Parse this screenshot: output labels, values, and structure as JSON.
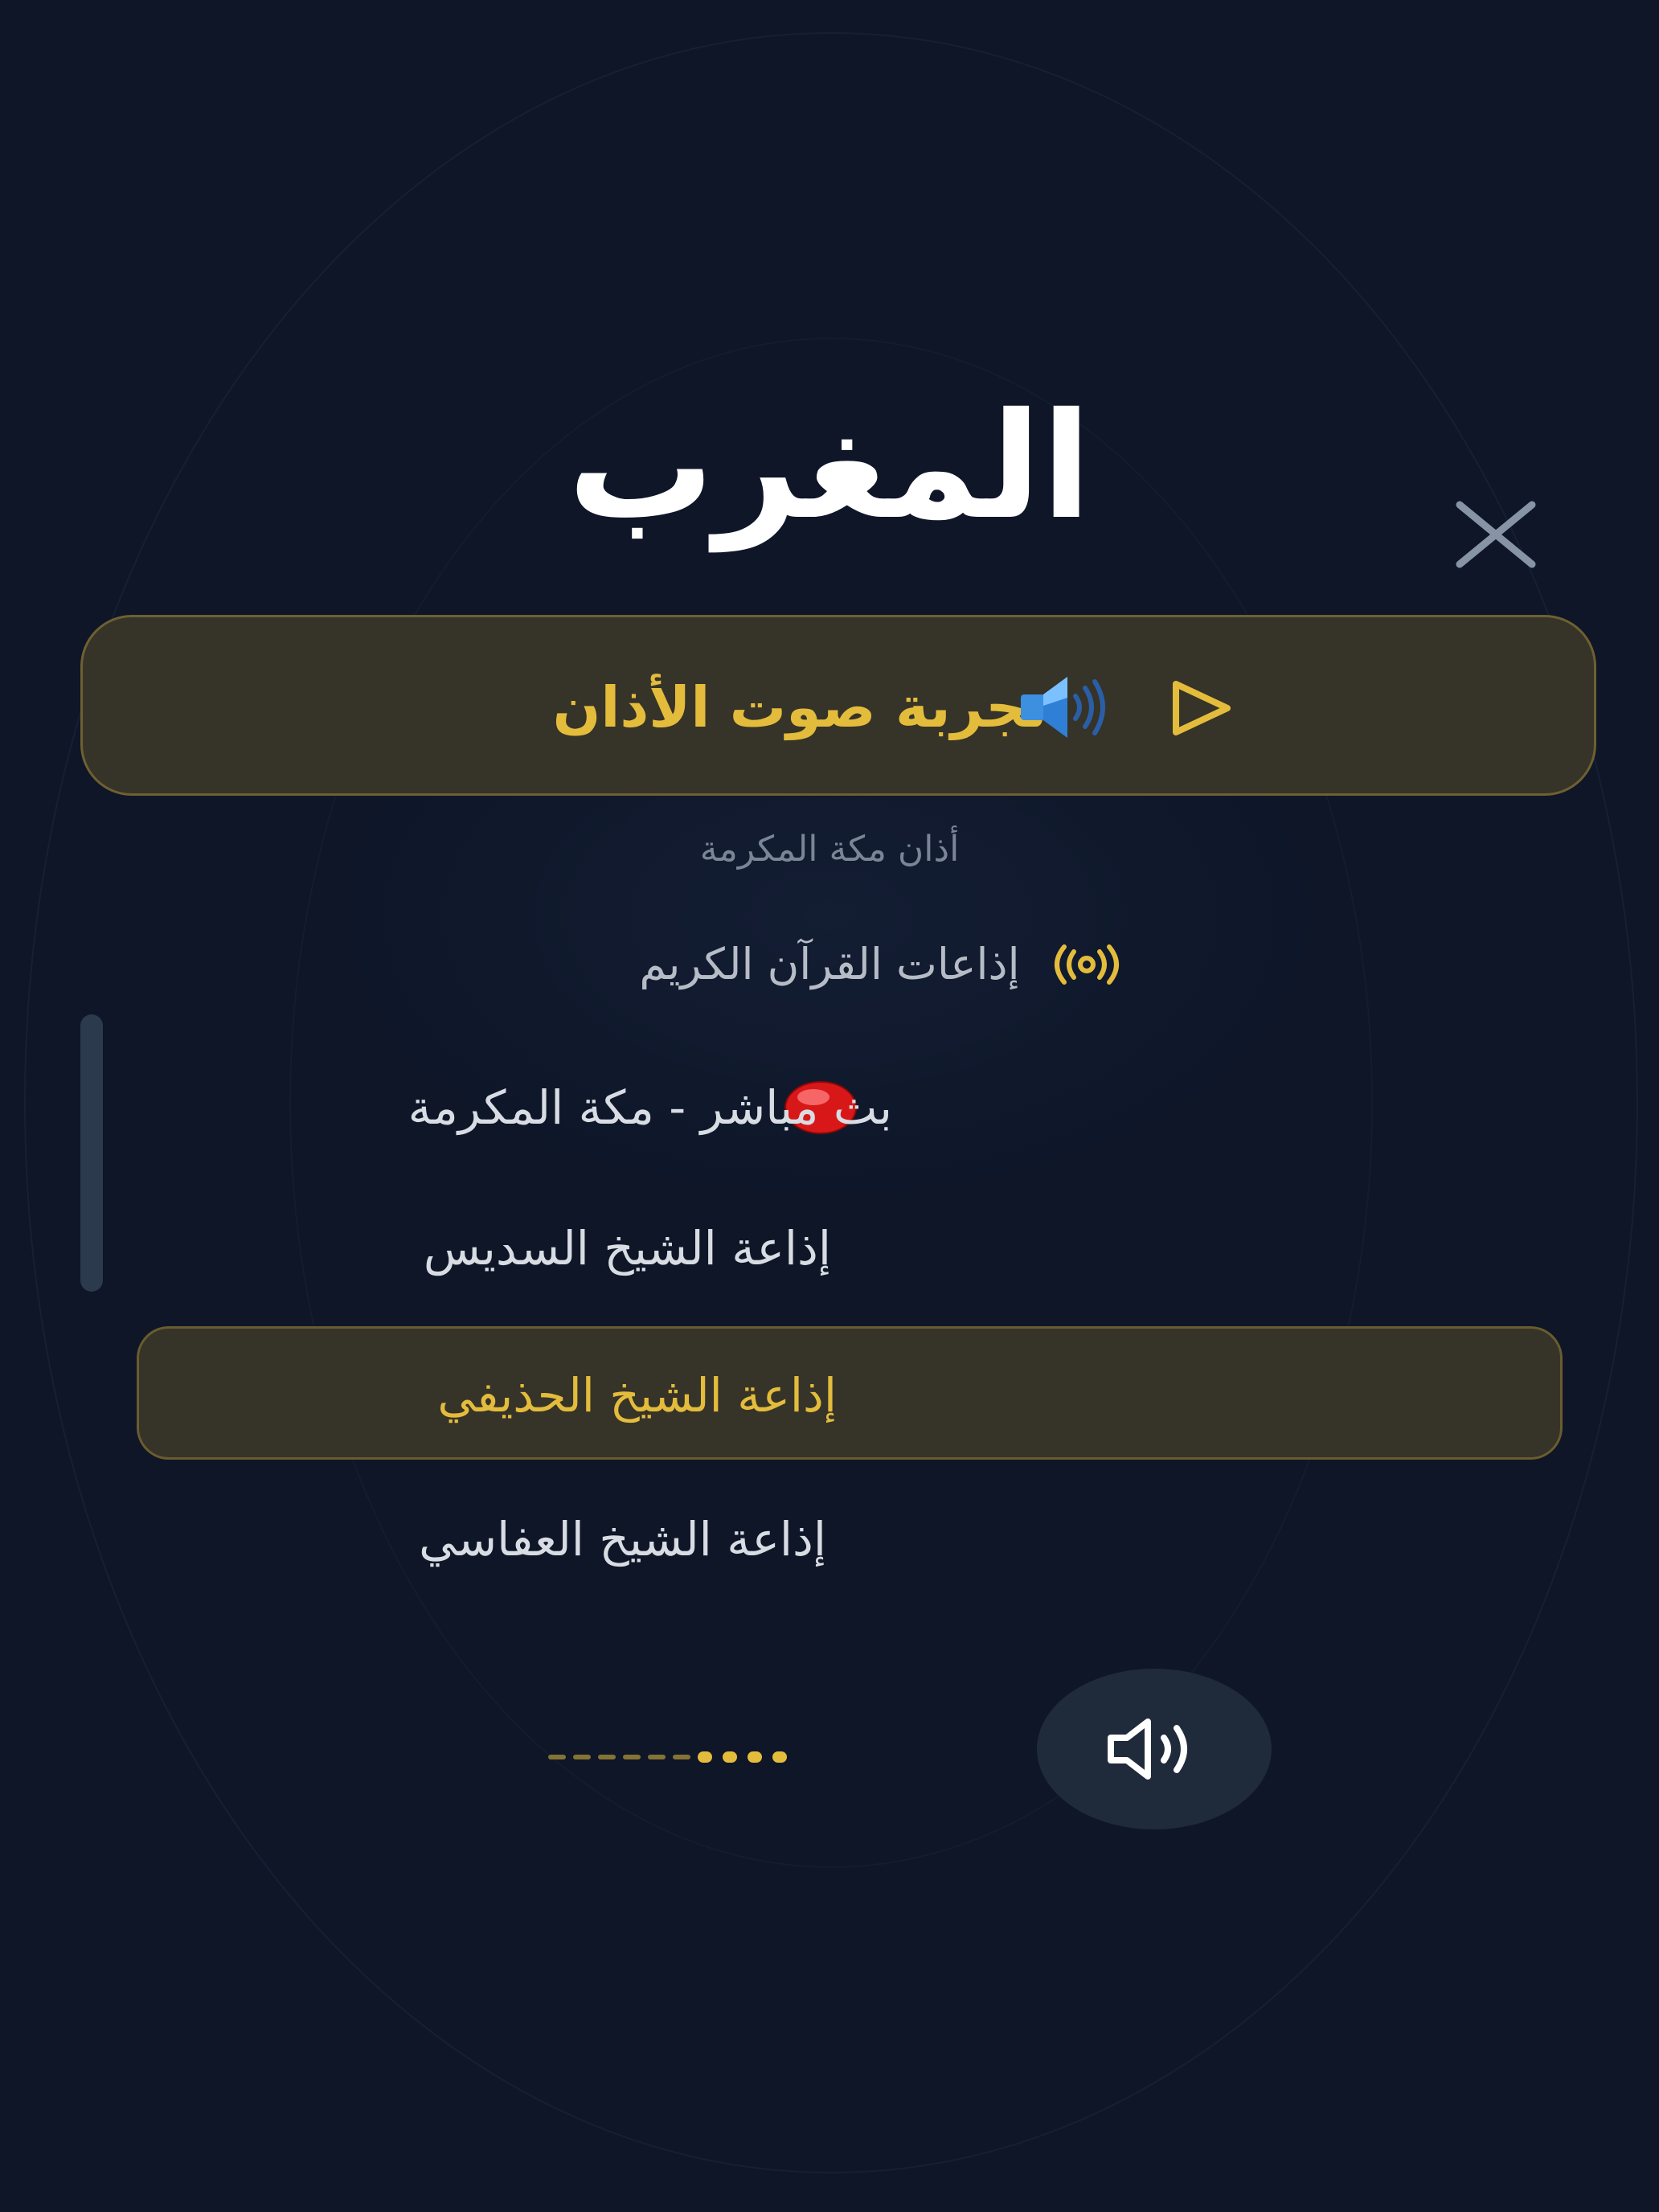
{
  "header": {
    "title": "المغرب",
    "close_icon": "close-icon"
  },
  "test_adhan": {
    "label": "تجربة صوت الأذان",
    "speaker_icon": "speaker-high-volume-emoji",
    "play_icon": "play-icon"
  },
  "adhan_name": "أذان مكة المكرمة",
  "radios_section": {
    "title": "إذاعات القرآن الكريم",
    "icon": "radio-broadcast-icon"
  },
  "radio_stations": [
    {
      "label": "بث مباشر - مكة المكرمة",
      "icon": "red-circle-emoji",
      "selected": false
    },
    {
      "label": "إذاعة الشيخ السديس",
      "selected": false
    },
    {
      "label": "إذاعة الشيخ الحذيفي",
      "selected": true
    },
    {
      "label": "إذاعة الشيخ العفاسي",
      "selected": false
    }
  ],
  "volume": {
    "icon": "volume-icon",
    "level": 0.4
  },
  "colors": {
    "background": "#0e1628",
    "accent": "#e4bc3c",
    "highlight_bg": "#363329",
    "text": "#d8dce3",
    "muted_text": "#7a8596"
  }
}
